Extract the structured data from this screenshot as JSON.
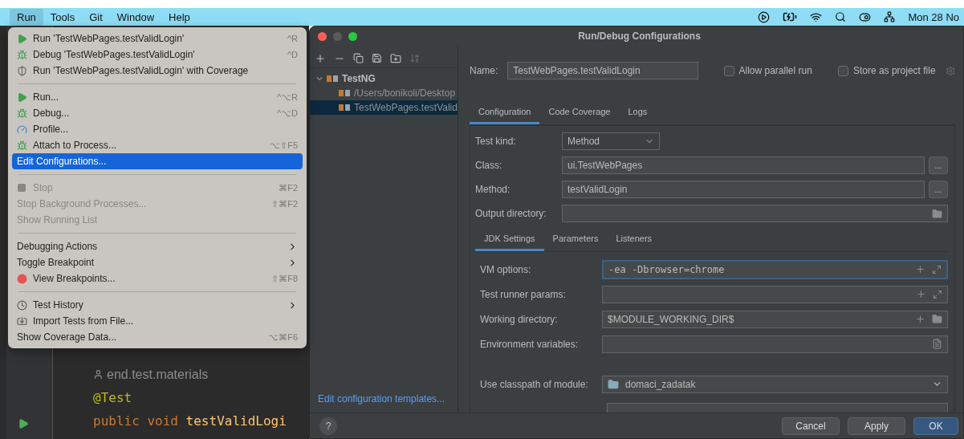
{
  "menu_bar": {
    "items": [
      {
        "label": "Run",
        "selected": true
      },
      {
        "label": "Tools",
        "selected": false
      },
      {
        "label": "Git",
        "selected": false
      },
      {
        "label": "Window",
        "selected": false
      },
      {
        "label": "Help",
        "selected": false
      }
    ],
    "clock": "Mon 28 No"
  },
  "run_menu": {
    "items": [
      {
        "kind": "item",
        "label": "Run 'TestWebPages.testValidLogin'",
        "shortcut": "^R",
        "disabled": false,
        "selected": false,
        "submenu": false
      },
      {
        "kind": "item",
        "label": "Debug 'TestWebPages.testValidLogin'",
        "shortcut": "^D",
        "disabled": false,
        "selected": false,
        "submenu": false
      },
      {
        "kind": "item",
        "label": "Run 'TestWebPages.testValidLogin' with Coverage",
        "disabled": false,
        "selected": false,
        "submenu": false
      },
      {
        "kind": "separator"
      },
      {
        "kind": "item",
        "label": "Run...",
        "shortcut": "^⌥R",
        "disabled": false,
        "selected": false,
        "submenu": false
      },
      {
        "kind": "item",
        "label": "Debug...",
        "shortcut": "^⌥D",
        "disabled": false,
        "selected": false,
        "submenu": false
      },
      {
        "kind": "item",
        "label": "Profile...",
        "disabled": false,
        "selected": false,
        "submenu": false
      },
      {
        "kind": "item",
        "label": "Attach to Process...",
        "shortcut": "⌥⇧F5",
        "disabled": false,
        "selected": false,
        "submenu": false
      },
      {
        "kind": "item",
        "label": "Edit Configurations...",
        "disabled": false,
        "selected": true,
        "submenu": false
      },
      {
        "kind": "separator"
      },
      {
        "kind": "item",
        "label": "Stop",
        "shortcut": "⌘F2",
        "disabled": true,
        "selected": false,
        "submenu": false
      },
      {
        "kind": "item",
        "label": "Stop Background Processes...",
        "shortcut": "⇧⌘F2",
        "disabled": true,
        "selected": false,
        "submenu": false
      },
      {
        "kind": "item",
        "label": "Show Running List",
        "disabled": true,
        "selected": false,
        "submenu": false
      },
      {
        "kind": "separator"
      },
      {
        "kind": "item",
        "label": "Debugging Actions",
        "disabled": false,
        "selected": false,
        "submenu": true
      },
      {
        "kind": "item",
        "label": "Toggle Breakpoint",
        "disabled": false,
        "selected": false,
        "submenu": true
      },
      {
        "kind": "item",
        "label": "View Breakpoints...",
        "shortcut": "⇧⌘F8",
        "disabled": false,
        "selected": false,
        "submenu": false
      },
      {
        "kind": "separator"
      },
      {
        "kind": "item",
        "label": "Test History",
        "disabled": false,
        "selected": false,
        "submenu": true
      },
      {
        "kind": "item",
        "label": "Import Tests from File...",
        "disabled": false,
        "selected": false,
        "submenu": false
      },
      {
        "kind": "item",
        "label": "Show Coverage Data...",
        "shortcut": "⌥⌘F6",
        "disabled": false,
        "selected": false,
        "submenu": false
      }
    ]
  },
  "editor": {
    "author_hint": "end.test.materials",
    "lines": [
      {
        "tokens": [
          {
            "kind": "annotation",
            "text": "@Test"
          }
        ]
      },
      {
        "tokens": [
          {
            "kind": "keyword",
            "text": "public void "
          },
          {
            "kind": "method",
            "text": "testValidLogi"
          }
        ]
      }
    ]
  },
  "dialog": {
    "title": "Run/Debug Configurations",
    "tree": [
      {
        "label": "TestNG",
        "expanded": true,
        "selected": false,
        "children": [
          {
            "label": "/Users/bonikoli/Desktop",
            "selected": false
          },
          {
            "label": "TestWebPages.testValid",
            "selected": true
          }
        ]
      }
    ],
    "templates_link": "Edit configuration templates...",
    "help": "?",
    "name_label": "Name:",
    "name_value": "TestWebPages.testValidLogin",
    "options": [
      {
        "label": "Allow parallel run",
        "checked": false
      },
      {
        "label": "Store as project file",
        "checked": false
      }
    ],
    "tabs": [
      {
        "label": "Configuration",
        "selected": true
      },
      {
        "label": "Code Coverage",
        "selected": false
      },
      {
        "label": "Logs",
        "selected": false
      }
    ],
    "fields": [
      {
        "kind": "select",
        "label": "Test kind:",
        "value": "Method"
      },
      {
        "kind": "browse",
        "label": "Class:",
        "value": "ui.TestWebPages",
        "button": "..."
      },
      {
        "kind": "browse",
        "label": "Method:",
        "value": "testValidLogin",
        "button": "..."
      },
      {
        "kind": "folder",
        "label": "Output directory:"
      }
    ],
    "sub_tabs": [
      {
        "label": "JDK Settings",
        "selected": true
      },
      {
        "label": "Parameters",
        "selected": false
      },
      {
        "label": "Listeners",
        "selected": false
      }
    ],
    "jdk_fields": [
      {
        "kind": "expand",
        "label": "VM options:",
        "value": "-ea -Dbrowser=chrome",
        "focused": true
      },
      {
        "kind": "expand",
        "label": "Test runner params:",
        "focused": false
      },
      {
        "kind": "path",
        "label": "Working directory:",
        "value": "$MODULE_WORKING_DIR$",
        "focused": false
      },
      {
        "kind": "document",
        "label": "Environment variables:",
        "focused": false
      },
      {
        "kind": "module",
        "label": "Use classpath of module:",
        "value": "domaci_zadatak",
        "focused": false
      }
    ],
    "buttons": [
      {
        "label": "Cancel",
        "primary": false
      },
      {
        "label": "Apply",
        "primary": false
      },
      {
        "label": "OK",
        "primary": true
      }
    ]
  }
}
